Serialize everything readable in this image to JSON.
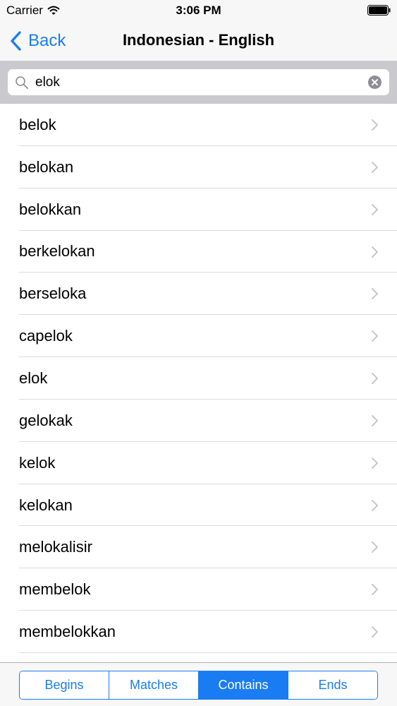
{
  "status_bar": {
    "carrier": "Carrier",
    "time": "3:06 PM"
  },
  "nav": {
    "back_label": "Back",
    "title": "Indonesian - English"
  },
  "search": {
    "value": "elok"
  },
  "results": [
    "belok",
    "belokan",
    "belokkan",
    "berkelokan",
    "berseloka",
    "capelok",
    "elok",
    "gelokak",
    "kelok",
    "kelokan",
    "melokalisir",
    "membelok",
    "membelokkan"
  ],
  "segments": {
    "options": [
      "Begins",
      "Matches",
      "Contains",
      "Ends"
    ],
    "selected": "Contains"
  },
  "colors": {
    "accent": "#1a7cf3",
    "bar_background": "#f7f7f7",
    "search_area_background": "#c9c9ce"
  },
  "icons": {
    "wifi": "wifi-icon",
    "battery": "battery-icon",
    "back": "chevron-left-icon",
    "search": "search-icon",
    "clear": "clear-icon",
    "row": "chevron-right-icon"
  }
}
